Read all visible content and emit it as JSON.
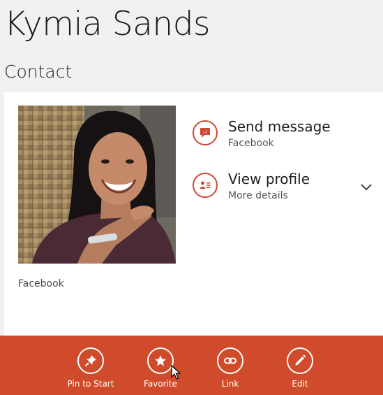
{
  "contact": {
    "name": "Kymia Sands",
    "section_title": "Contact",
    "photo_source": "Facebook"
  },
  "actions": [
    {
      "title": "Send message",
      "subtitle": "Facebook",
      "icon": "message-bubble-icon"
    },
    {
      "title": "View profile",
      "subtitle": "More details",
      "icon": "profile-card-icon",
      "expandable": true
    }
  ],
  "appbar": {
    "buttons": [
      {
        "label": "Pin to Start",
        "icon": "pin-icon"
      },
      {
        "label": "Favorite",
        "icon": "star-icon"
      },
      {
        "label": "Link",
        "icon": "link-icon"
      },
      {
        "label": "Edit",
        "icon": "pencil-icon"
      }
    ]
  },
  "colors": {
    "accent": "#d04b2b",
    "icon_accent": "#cc4a31",
    "background": "#f1f1f1",
    "card": "#ffffff"
  }
}
